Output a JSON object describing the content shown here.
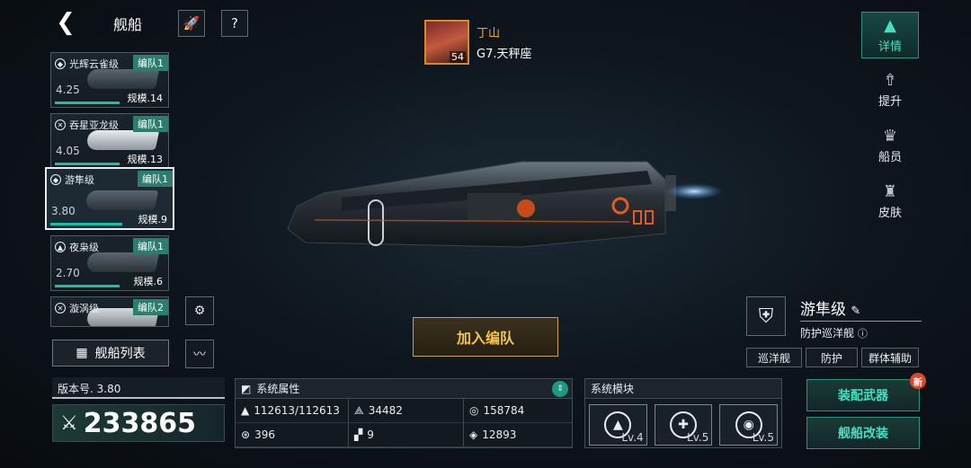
{
  "header": {
    "title": "舰船"
  },
  "commander": {
    "name": "丁山",
    "system": "G7.天秤座",
    "level": "54"
  },
  "ships": [
    {
      "name": "光辉云雀级",
      "fleet": "编队1",
      "version": "4.25",
      "scale": "规模.14"
    },
    {
      "name": "吞星亚龙级",
      "fleet": "编队1",
      "version": "4.05",
      "scale": "规模.13"
    },
    {
      "name": "游隼级",
      "fleet": "编队1",
      "version": "3.80",
      "scale": "规模.9"
    },
    {
      "name": "夜枭级",
      "fleet": "编队1",
      "version": "2.70",
      "scale": "规模.6"
    },
    {
      "name": "漩涡级",
      "fleet": "编队2",
      "version": "",
      "scale": ""
    }
  ],
  "fleet_list_label": "舰船列表",
  "version_label": "版本号. 3.80",
  "power": "233865",
  "join_label": "加入编队",
  "attributes": {
    "title": "系统属性",
    "cells": [
      "112613/112613",
      "34482",
      "158784",
      "396",
      "9",
      "12893"
    ]
  },
  "modules": {
    "title": "系统模块",
    "items": [
      {
        "level": "Lv.4"
      },
      {
        "level": "Lv.5"
      },
      {
        "level": "Lv.5"
      }
    ]
  },
  "tabs": [
    {
      "label": "详情",
      "active": true
    },
    {
      "label": "提升"
    },
    {
      "label": "船员"
    },
    {
      "label": "皮肤"
    }
  ],
  "ship_info": {
    "class_name": "游隼级",
    "type": "防护巡洋舰",
    "chips": [
      "巡洋舰",
      "防护",
      "群体辅助"
    ]
  },
  "actions": {
    "equip": "装配武器",
    "modify": "舰船改装",
    "new_badge": "新"
  },
  "colors": {
    "accent": "#43e0c4",
    "fleet_tag": "#2d7d6e",
    "join_text": "#f3c44c",
    "commander_name": "#f3a33a"
  }
}
